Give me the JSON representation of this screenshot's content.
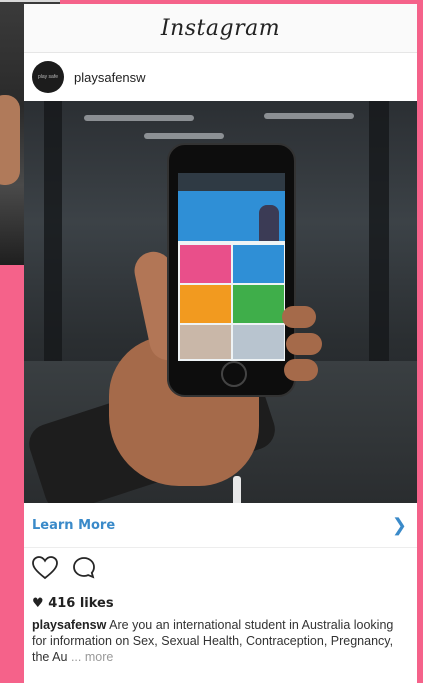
{
  "header": {
    "logo_text": "Instagram"
  },
  "post": {
    "avatar_text": "play safe",
    "username": "playsafensw",
    "cta_label": "Learn More",
    "cta_icon": "chevron-right-icon",
    "actions": [
      "heart-icon",
      "comment-icon"
    ],
    "likes_text": "416 likes",
    "caption_user": "playsafensw",
    "caption_text": "Are you an international student in Australia looking for information on Sex, Sexual Health, Contraception, Pregnancy, the Au",
    "caption_more": "... more"
  },
  "colors": {
    "page_bg": "#f5628a",
    "link_blue": "#3a8ac9"
  }
}
